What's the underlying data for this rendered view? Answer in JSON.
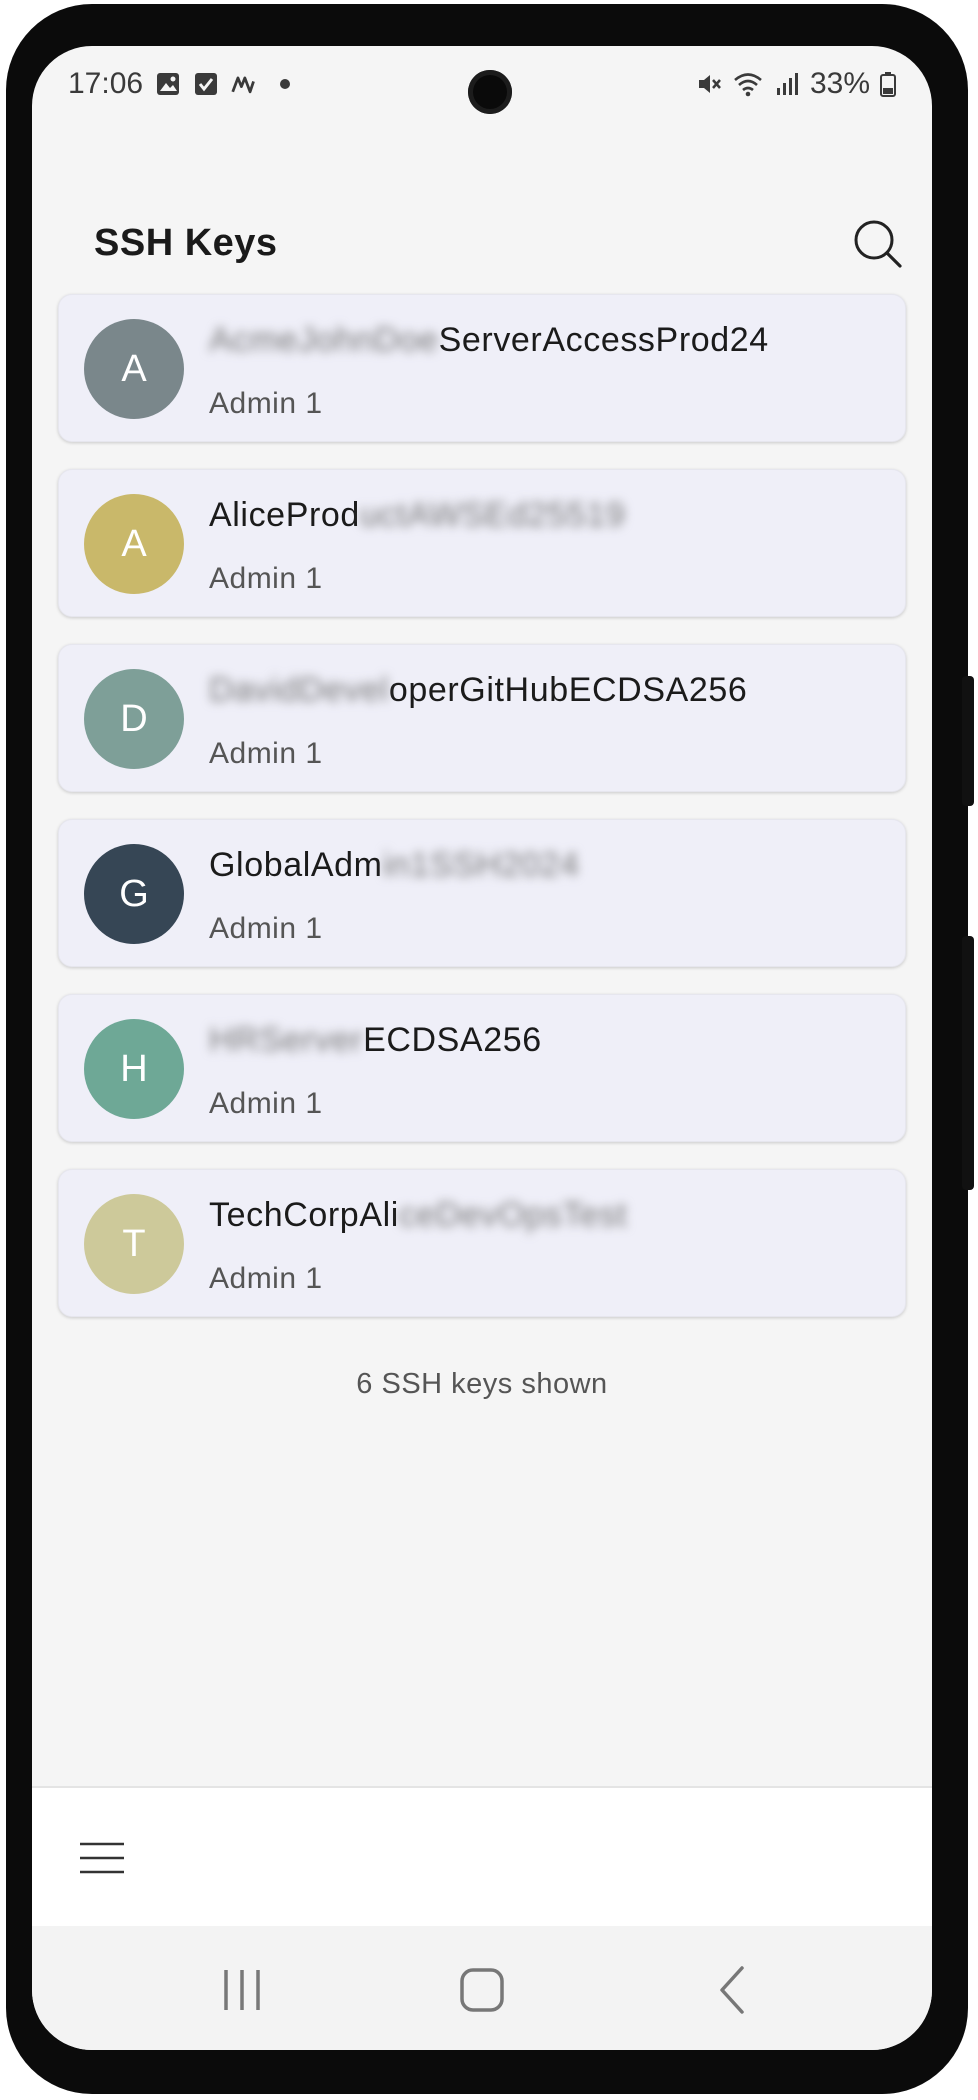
{
  "status_bar": {
    "time": "17:06",
    "battery": "33%",
    "icons_left": [
      "image-icon",
      "checkbox-icon",
      "app-icon",
      "dot-icon"
    ],
    "icons_right": [
      "mute-icon",
      "wifi-icon",
      "signal-icon",
      "battery-icon"
    ]
  },
  "header": {
    "title": "SSH Keys",
    "search_icon": "search-icon"
  },
  "keys": [
    {
      "initial": "A",
      "name_visible": "ServerAccessProd24",
      "name_blurred": "AcmeJohnDoe",
      "blur_first": true,
      "subtitle": "Admin 1",
      "color": "#7a878b"
    },
    {
      "initial": "A",
      "name_visible": "AliceProd",
      "name_blurred": "uctAWSEd25519",
      "blur_first": false,
      "subtitle": "Admin 1",
      "color": "#c9b86a"
    },
    {
      "initial": "D",
      "name_visible": "operGitHubECDSA256",
      "name_blurred": "DavidDevel",
      "blur_first": true,
      "subtitle": "Admin 1",
      "color": "#7e9f98"
    },
    {
      "initial": "G",
      "name_visible": "GlobalAdm",
      "name_blurred": "in1SSH2024",
      "blur_first": false,
      "subtitle": "Admin 1",
      "color": "#364655"
    },
    {
      "initial": "H",
      "name_visible": "ECDSA256",
      "name_blurred": "HRServer",
      "blur_first": true,
      "subtitle": "Admin 1",
      "color": "#6ea896"
    },
    {
      "initial": "T",
      "name_visible": "TechCorpAli",
      "name_blurred": "ceDevOpsTest",
      "blur_first": false,
      "subtitle": "Admin 1",
      "color": "#cdc99a"
    }
  ],
  "footer": {
    "count_text": "6 SSH keys shown"
  },
  "bottom_bar": {
    "menu_icon": "menu-icon"
  },
  "system_nav": {
    "recents": "recents-icon",
    "home": "home-icon",
    "back": "back-icon"
  }
}
